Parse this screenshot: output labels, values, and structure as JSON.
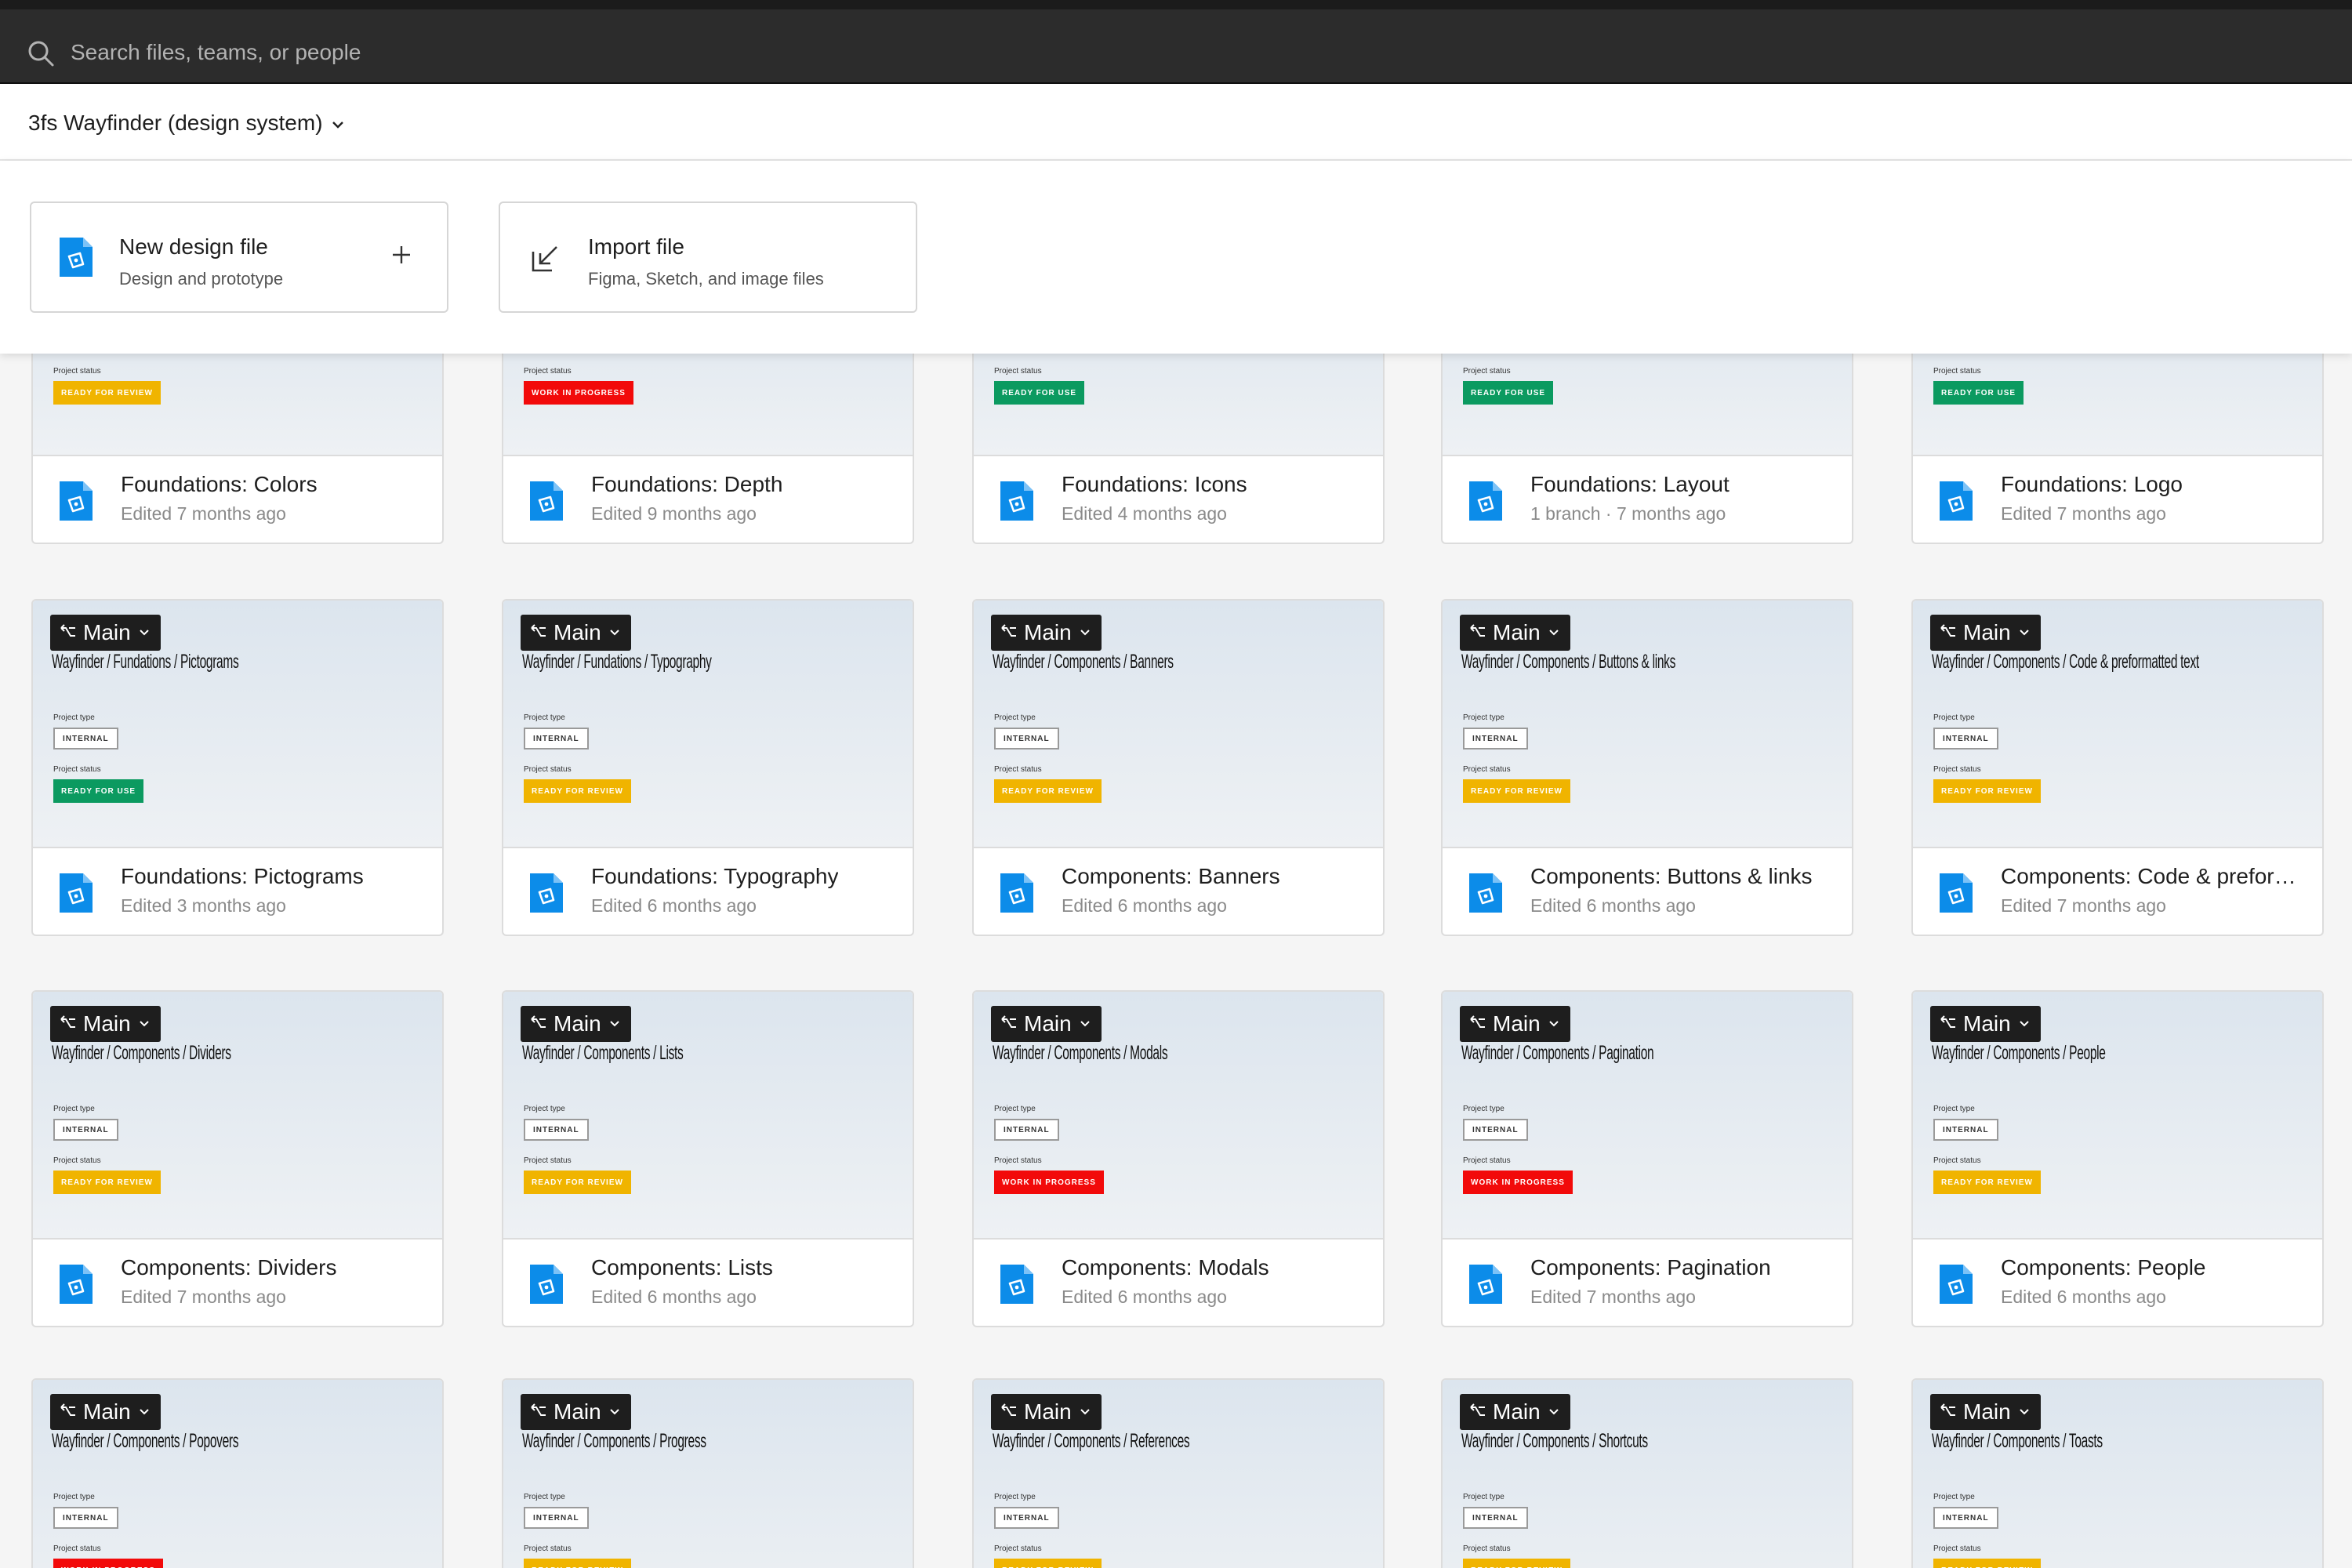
{
  "search": {
    "placeholder": "Search files, teams, or people"
  },
  "team": {
    "name": "3fs Wayfinder (design system)"
  },
  "actions": [
    {
      "title": "New design file",
      "subtitle": "Design and prototype"
    },
    {
      "title": "Import file",
      "subtitle": "Figma, Sketch, and image files"
    }
  ],
  "colors": {
    "ready_for_review": "#f0b400",
    "ready_for_use": "#0b9a60",
    "work_in_progress": "#f20a0a",
    "file_icon": "#0c8ce9"
  },
  "labels": {
    "project_type": "Project type",
    "project_status": "Project status",
    "internal": "INTERNAL"
  },
  "row1": [
    {
      "title": "Foundations: Colors",
      "sub": "Edited 7 months ago",
      "status_label": "Project status",
      "status": "READY FOR REVIEW"
    },
    {
      "title": "Foundations: Depth",
      "sub": "Edited 9 months ago",
      "status_label": "Project status",
      "status": "WORK IN PROGRESS"
    },
    {
      "title": "Foundations: Icons",
      "sub": "Edited 4 months ago",
      "status_label": "Project status",
      "status": "READY FOR USE"
    },
    {
      "title": "Foundations: Layout",
      "sub": "1 branch · 7 months ago",
      "status_label": "Project status",
      "status": "READY FOR USE"
    },
    {
      "title": "Foundations: Logo",
      "sub": "Edited 7 months ago",
      "status_label": "Project status",
      "status": "READY FOR USE"
    }
  ],
  "row2": [
    {
      "branch": "Main",
      "path": "Wayfinder / Fundations / Pictograms",
      "status": "READY FOR USE",
      "title": "Foundations: Pictograms",
      "sub": "Edited 3 months ago"
    },
    {
      "branch": "Main",
      "path": "Wayfinder / Fundations / Typography",
      "status": "READY FOR REVIEW",
      "title": "Foundations: Typography",
      "sub": "Edited 6 months ago"
    },
    {
      "branch": "Main",
      "path": "Wayfinder / Components / Banners",
      "status": "READY FOR REVIEW",
      "title": "Components: Banners",
      "sub": "Edited 6 months ago"
    },
    {
      "branch": "Main",
      "path": "Wayfinder / Components / Buttons & links",
      "status": "READY FOR REVIEW",
      "title": "Components: Buttons & links",
      "sub": "Edited 6 months ago"
    },
    {
      "branch": "Main",
      "path": "Wayfinder / Components / Code & preformatted text",
      "status": "READY FOR REVIEW",
      "title": "Components: Code & preform...",
      "sub": "Edited 7 months ago"
    }
  ],
  "row3": [
    {
      "branch": "Main",
      "path": "Wayfinder / Components / Dividers",
      "status": "READY FOR REVIEW",
      "title": "Components: Dividers",
      "sub": "Edited 7 months ago"
    },
    {
      "branch": "Main",
      "path": "Wayfinder / Components / Lists",
      "status": "READY FOR REVIEW",
      "title": "Components: Lists",
      "sub": "Edited 6 months ago"
    },
    {
      "branch": "Main",
      "path": "Wayfinder / Components / Modals",
      "status": "WORK IN PROGRESS",
      "title": "Components: Modals",
      "sub": "Edited 6 months ago"
    },
    {
      "branch": "Main",
      "path": "Wayfinder / Components / Pagination",
      "status": "WORK IN PROGRESS",
      "title": "Components: Pagination",
      "sub": "Edited 7 months ago"
    },
    {
      "branch": "Main",
      "path": "Wayfinder / Components / People",
      "status": "READY FOR REVIEW",
      "title": "Components: People",
      "sub": "Edited 6 months ago"
    }
  ],
  "row4": [
    {
      "branch": "Main",
      "path": "Wayfinder / Components / Popovers",
      "status": "WORK IN PROGRESS"
    },
    {
      "branch": "Main",
      "path": "Wayfinder / Components / Progress",
      "status": "READY FOR REVIEW"
    },
    {
      "branch": "Main",
      "path": "Wayfinder / Components / References",
      "status": "READY FOR REVIEW"
    },
    {
      "branch": "Main",
      "path": "Wayfinder / Components / Shortcuts",
      "status": "READY FOR REVIEW"
    },
    {
      "branch": "Main",
      "path": "Wayfinder / Components / Toasts",
      "status": "READY FOR REVIEW"
    }
  ]
}
